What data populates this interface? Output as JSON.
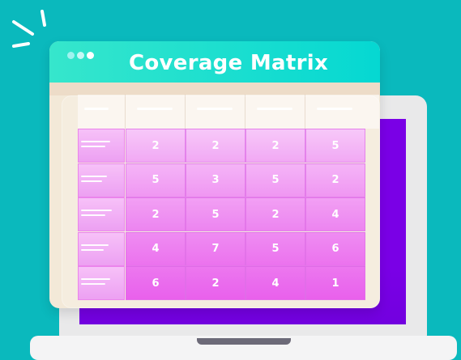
{
  "title": "Coverage Matrix",
  "matrix": [
    [
      "2",
      "2",
      "2",
      "5"
    ],
    [
      "5",
      "3",
      "5",
      "2"
    ],
    [
      "2",
      "5",
      "2",
      "4"
    ],
    [
      "4",
      "7",
      "5",
      "6"
    ],
    [
      "6",
      "2",
      "4",
      "1"
    ]
  ],
  "colors": {
    "background": "#0ab9bd",
    "header": "#05d8d2",
    "screen": "#7a00e6",
    "cell_top": "#f6c3f8",
    "cell_bottom": "#e43fe8"
  }
}
